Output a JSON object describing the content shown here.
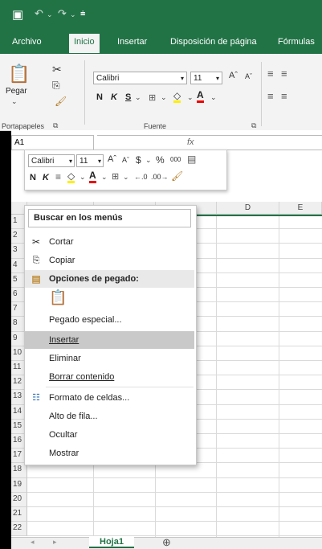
{
  "quick_access": {
    "save_icon": "save-icon",
    "undo_icon": "undo-icon",
    "redo_icon": "redo-icon",
    "customize_icon": "customize-icon"
  },
  "tabs": [
    {
      "label": "Archivo",
      "active": false
    },
    {
      "label": "Inicio",
      "active": true
    },
    {
      "label": "Insertar",
      "active": false
    },
    {
      "label": "Disposición de página",
      "active": false
    },
    {
      "label": "Fórmulas",
      "active": false
    }
  ],
  "ribbon": {
    "paste_label": "Pegar",
    "font_name": "Calibri",
    "font_size": "11",
    "bold": "N",
    "italic": "K",
    "underline": "S",
    "group_clipboard": "Portapapeles",
    "group_font": "Fuente"
  },
  "formula_bar": {
    "name_box": "A1",
    "fx": "fx"
  },
  "columns": [
    "D",
    "E"
  ],
  "rows": [
    "1",
    "2",
    "3",
    "4",
    "5",
    "6",
    "7",
    "8",
    "9",
    "10",
    "11",
    "12",
    "13",
    "14",
    "15",
    "16",
    "17",
    "18",
    "19",
    "20",
    "21",
    "22"
  ],
  "mini_toolbar": {
    "font_name": "Calibri",
    "font_size": "11",
    "currency": "$",
    "percent": "%",
    "thousands": "000",
    "bold": "N",
    "italic": "K"
  },
  "context_menu": {
    "search_placeholder": "Buscar en los menús",
    "items": [
      {
        "label": "Cortar",
        "icon": "scissors-icon"
      },
      {
        "label": "Copiar",
        "icon": "copy-icon"
      },
      {
        "label": "Opciones de pegado:",
        "icon": "paste-icon",
        "section": true
      },
      {
        "label": "Pegado especial...",
        "icon": ""
      },
      {
        "label": "Insertar",
        "icon": "",
        "highlighted": true
      },
      {
        "label": "Eliminar",
        "icon": ""
      },
      {
        "label": "Borrar contenido",
        "icon": ""
      },
      {
        "label": "Formato de celdas...",
        "icon": "format-cells-icon"
      },
      {
        "label": "Alto de fila...",
        "icon": ""
      },
      {
        "label": "Ocultar",
        "icon": ""
      },
      {
        "label": "Mostrar",
        "icon": ""
      }
    ]
  },
  "sheet_tabs": {
    "active": "Hoja1",
    "add": "⊕"
  },
  "colors": {
    "accent": "#217346",
    "highlight": "#c9c9c9"
  }
}
